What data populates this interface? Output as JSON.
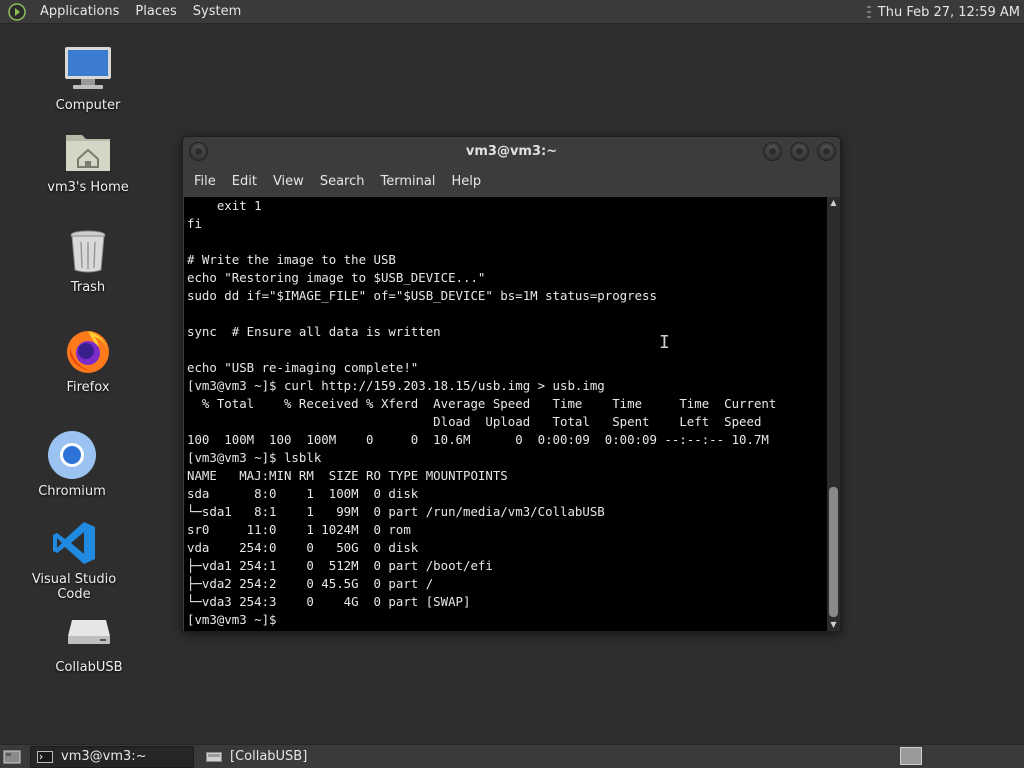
{
  "top_panel": {
    "menus": [
      "Applications",
      "Places",
      "System"
    ],
    "clock": "Thu Feb 27, 12:59 AM"
  },
  "desktop": {
    "icons": [
      {
        "label": "Computer",
        "icon": "computer-icon"
      },
      {
        "label": "vm3's Home",
        "icon": "home-folder-icon"
      },
      {
        "label": "Trash",
        "icon": "trash-icon"
      },
      {
        "label": "Firefox",
        "icon": "firefox-icon"
      },
      {
        "label": "Chromium",
        "icon": "chromium-icon"
      },
      {
        "label": "Visual Studio Code",
        "icon": "vscode-icon"
      },
      {
        "label": "CollabUSB",
        "icon": "usb-drive-icon"
      }
    ]
  },
  "window": {
    "title": "vm3@vm3:~",
    "menu": [
      "File",
      "Edit",
      "View",
      "Search",
      "Terminal",
      "Help"
    ],
    "lines": [
      "    exit 1",
      "fi",
      "",
      "# Write the image to the USB",
      "echo \"Restoring image to $USB_DEVICE...\"",
      "sudo dd if=\"$IMAGE_FILE\" of=\"$USB_DEVICE\" bs=1M status=progress",
      "",
      "sync  # Ensure all data is written",
      "",
      "echo \"USB re-imaging complete!\"",
      "[vm3@vm3 ~]$ curl http://159.203.18.15/usb.img > usb.img",
      "  % Total    % Received % Xferd  Average Speed   Time    Time     Time  Current",
      "                                 Dload  Upload   Total   Spent    Left  Speed",
      "100  100M  100  100M    0     0  10.6M      0  0:00:09  0:00:09 --:--:-- 10.7M",
      "[vm3@vm3 ~]$ lsblk",
      "NAME   MAJ:MIN RM  SIZE RO TYPE MOUNTPOINTS",
      "sda      8:0    1  100M  0 disk",
      "└─sda1   8:1    1   99M  0 part /run/media/vm3/CollabUSB",
      "sr0     11:0    1 1024M  0 rom",
      "vda    254:0    0   50G  0 disk",
      "├─vda1 254:1    0  512M  0 part /boot/efi",
      "├─vda2 254:2    0 45.5G  0 part /",
      "└─vda3 254:3    0    4G  0 part [SWAP]",
      "[vm3@vm3 ~]$ "
    ]
  },
  "taskbar": {
    "tasks": [
      "vm3@vm3:~",
      "[CollabUSB]"
    ]
  }
}
